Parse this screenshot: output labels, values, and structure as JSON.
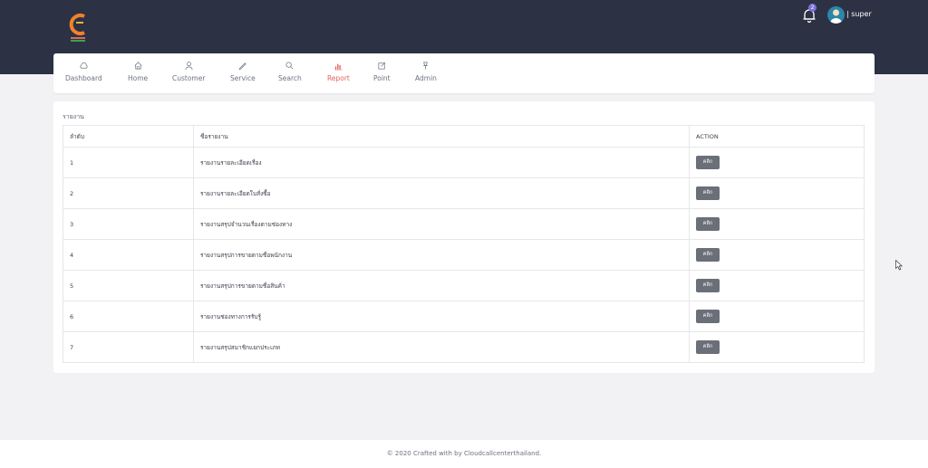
{
  "header": {
    "notification_count": "2",
    "user_name": "| super"
  },
  "nav": {
    "items": [
      {
        "label": "Dashboard",
        "icon": "cloud-icon"
      },
      {
        "label": "Home",
        "icon": "home-icon"
      },
      {
        "label": "Customer",
        "icon": "user-icon"
      },
      {
        "label": "Service",
        "icon": "pen-icon"
      },
      {
        "label": "Search",
        "icon": "search-icon"
      },
      {
        "label": "Report",
        "icon": "bar-chart-icon",
        "active": true
      },
      {
        "label": "Point",
        "icon": "edit-icon"
      },
      {
        "label": "Admin",
        "icon": "pin-icon"
      }
    ],
    "active_color": "#e0645c"
  },
  "report": {
    "heading": "รายงาน",
    "columns": [
      "ลำดับ",
      "ชื่อรายงาน",
      "ACTION"
    ],
    "button_label": "คลิก",
    "rows": [
      {
        "num": "1",
        "name": "รายงานรายละเอียดเรื่อง"
      },
      {
        "num": "2",
        "name": "รายงานรายละเอียดใบสั่งซื้อ"
      },
      {
        "num": "3",
        "name": "รายงานสรุปจำนวนเรื่องตามช่องทาง"
      },
      {
        "num": "4",
        "name": "รายงานสรุปการขายตามชื่อพนักงาน"
      },
      {
        "num": "5",
        "name": "รายงานสรุปการขายตามชื่อสินค้า"
      },
      {
        "num": "6",
        "name": "รายงานช่องทางการรับรู้"
      },
      {
        "num": "7",
        "name": "รายงานสรุปสมาชิกแยกประเภท"
      }
    ]
  },
  "footer": {
    "text": "© 2020 Crafted with by Cloudcallcenterthailand."
  },
  "colors": {
    "topbar": "#2c3244",
    "button": "#6b6f78",
    "accent": "#e0645c"
  }
}
